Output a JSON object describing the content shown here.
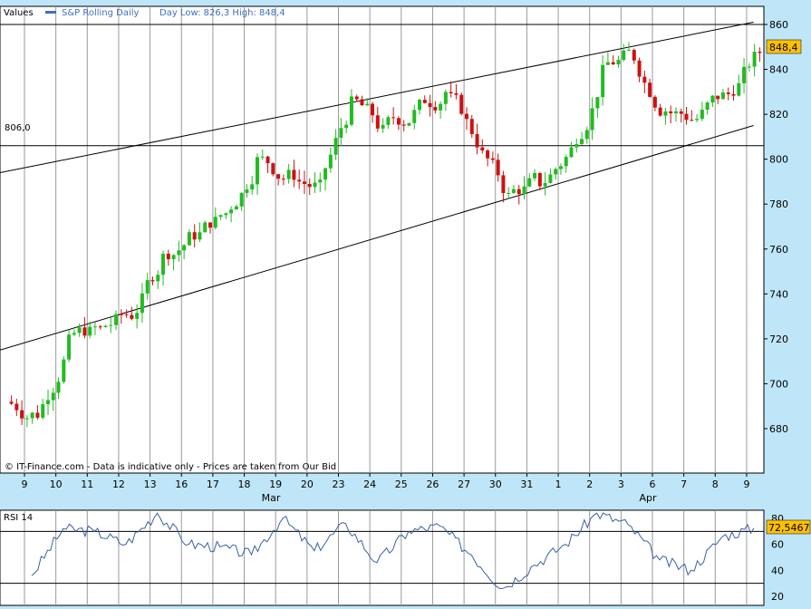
{
  "header": {
    "values_label": "Values",
    "series_name": "S&P Rolling Daily",
    "day_range": "Day Low: 826,3 High: 848,4",
    "series_color": "#3a6fc7"
  },
  "watermark": "© IT-Finance.com - Data is indicative only - Prices are taken from Our Bid",
  "chart_data": [
    {
      "type": "candlestick",
      "title": "S&P Rolling Daily",
      "y_ticks": [
        680,
        700,
        720,
        740,
        760,
        780,
        800,
        820,
        840,
        860
      ],
      "ylim": [
        666,
        862
      ],
      "x_ticks": [
        "9",
        "10",
        "11",
        "12",
        "13",
        "16",
        "17",
        "18",
        "19",
        "20",
        "23",
        "24",
        "25",
        "26",
        "27",
        "30",
        "31",
        "1",
        "2",
        "3",
        "6",
        "7",
        "8",
        "9"
      ],
      "months": [
        "Mar",
        "Apr"
      ],
      "grid": true,
      "up_color": "#22bb22",
      "down_color": "#cc1111",
      "last_price": "848,4",
      "level_line": {
        "label": "806,0",
        "value": 806
      },
      "channel_lines": [
        {
          "from": {
            "x": 0,
            "y": 794
          },
          "to": {
            "x": 24,
            "y": 861
          }
        },
        {
          "from": {
            "x": 0,
            "y": 715
          },
          "to": {
            "x": 24,
            "y": 815
          }
        }
      ],
      "daily_close": [
        687,
        718,
        724,
        731,
        756,
        767,
        776,
        799,
        792,
        787,
        824,
        812,
        820,
        830,
        808,
        783,
        790,
        804,
        838,
        846,
        822,
        818,
        829,
        848
      ]
    },
    {
      "type": "line",
      "title": "RSI 14",
      "y_ticks": [
        20,
        40,
        60,
        80
      ],
      "ylim": [
        17,
        91
      ],
      "ref_lines": [
        30,
        70
      ],
      "last_value": "72,5467",
      "line_color": "#3a5fa8",
      "x": [
        0,
        1,
        2,
        3,
        4,
        5,
        6,
        7,
        8,
        9,
        10,
        11,
        12,
        13,
        14,
        15,
        16,
        17,
        18,
        19,
        20,
        21,
        22,
        23
      ],
      "values": [
        36,
        72,
        70,
        60,
        84,
        60,
        58,
        52,
        80,
        55,
        76,
        46,
        70,
        74,
        52,
        26,
        44,
        60,
        84,
        75,
        48,
        40,
        66,
        72.5
      ]
    }
  ]
}
